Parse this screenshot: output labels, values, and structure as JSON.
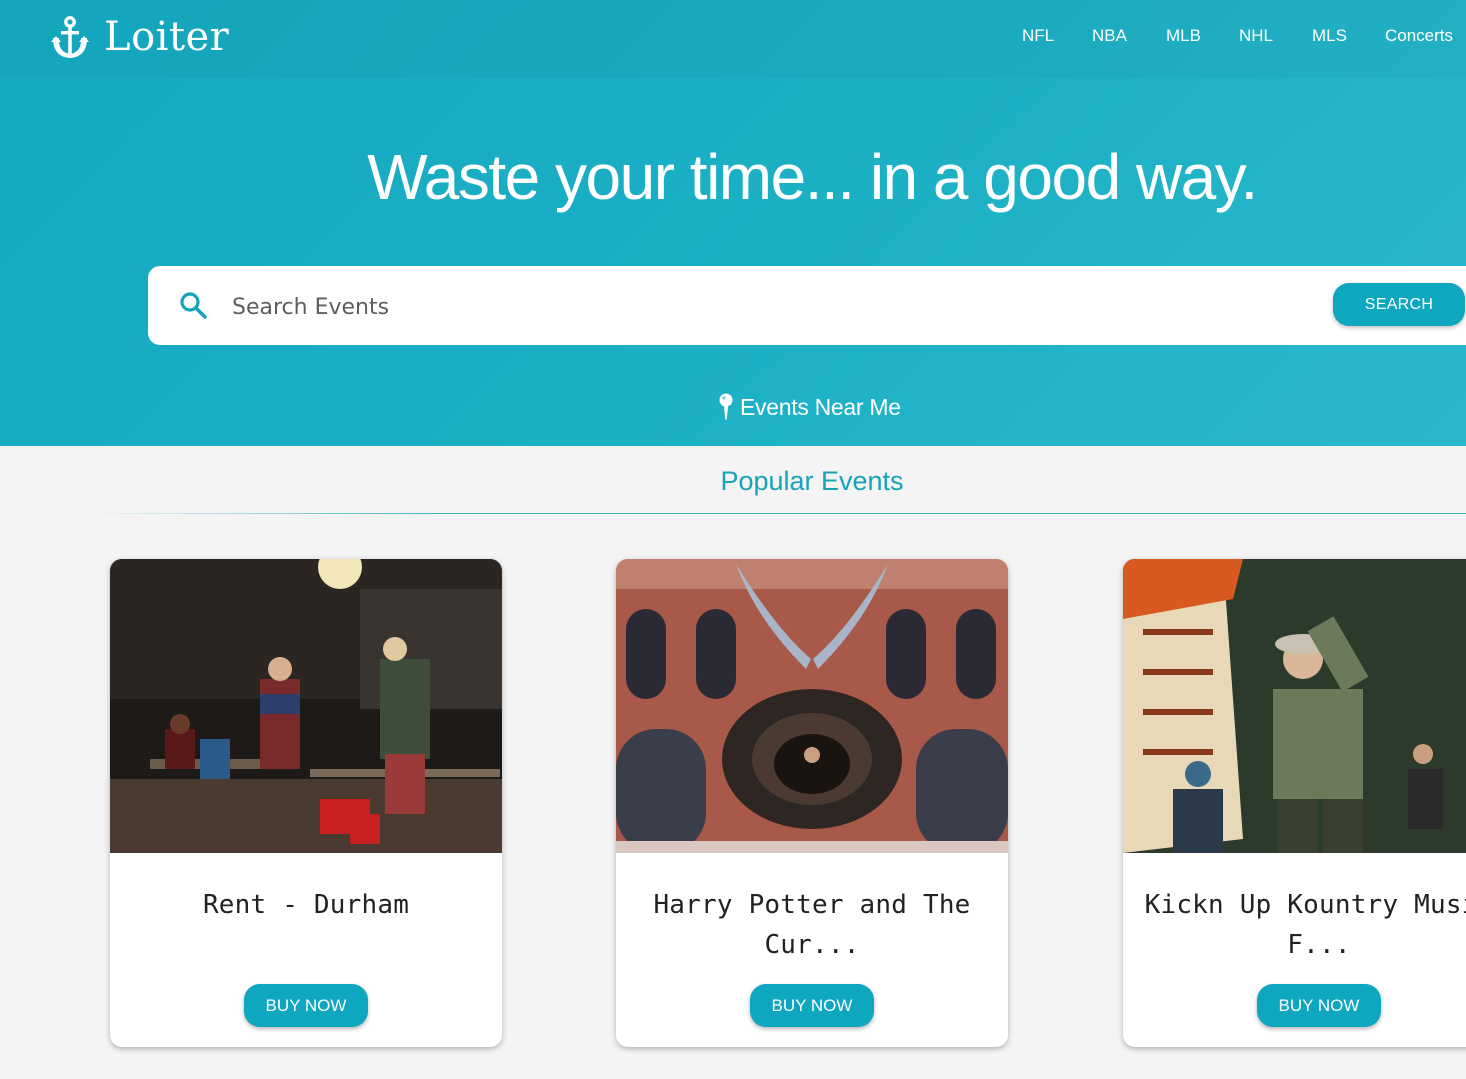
{
  "header": {
    "brand": "Loiter",
    "logo_icon": "anchor-icon",
    "nav": [
      "NFL",
      "NBA",
      "MLB",
      "NHL",
      "MLS",
      "Concerts"
    ]
  },
  "hero": {
    "headline": "Waste your time... in a good way.",
    "search": {
      "placeholder": "Search Events",
      "value": "",
      "button_label": "SEARCH",
      "icon": "search-icon"
    },
    "near_me": {
      "label": "Events Near Me",
      "icon": "map-pin-icon"
    }
  },
  "popular": {
    "title": "Popular Events",
    "cards": [
      {
        "title": "Rent - Durham",
        "button": "BUY NOW"
      },
      {
        "title": "Harry Potter and The Cur...",
        "button": "BUY NOW"
      },
      {
        "title": "Kickn Up Kountry Music F...",
        "button": "BUY NOW"
      }
    ]
  },
  "colors": {
    "accent": "#0fa6bf",
    "hero_bg": "#1cb0c5",
    "page_bg": "#f4f4f4",
    "section_title": "#17a3ba"
  }
}
